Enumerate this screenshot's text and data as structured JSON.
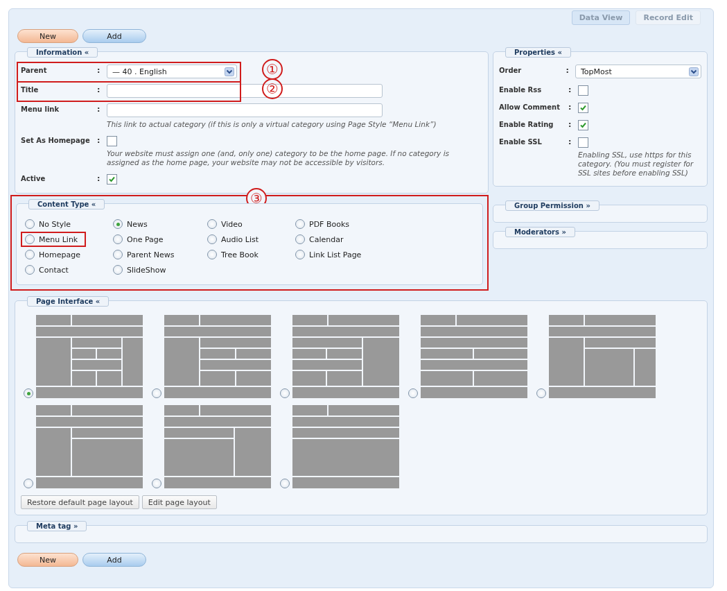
{
  "tabs": [
    {
      "label": "Data View",
      "selected": true
    },
    {
      "label": "Record Edit",
      "selected": false
    }
  ],
  "top_buttons": [
    {
      "label": "New",
      "kind": "primary"
    },
    {
      "label": "Add",
      "kind": "secondary"
    }
  ],
  "information": {
    "title": "Information «",
    "fields": [
      {
        "kind": "select",
        "label": "Parent",
        "colon": ":",
        "value": "— 40 . English",
        "highlighted": true,
        "callout": "①"
      },
      {
        "kind": "text",
        "label": "Title",
        "colon": ":",
        "highlighted": true,
        "callout": "②"
      },
      {
        "kind": "text",
        "label": "Menu link",
        "colon": ":",
        "hint": "This link to actual category (if this is only a virtual category using Page Style “Menu Link”)"
      },
      {
        "kind": "checkbox",
        "label": "Set As Homepage",
        "colon": ":",
        "checked": false,
        "hint": "Your website must assign one (and, only one) category to be the home page. If no category is assigned as the home page, your website may not be accessible by visitors."
      },
      {
        "kind": "checkbox",
        "label": "Active",
        "colon": ":",
        "checked": true
      }
    ]
  },
  "properties": {
    "title": "Properties «",
    "fields": [
      {
        "kind": "select",
        "label": "Order",
        "colon": ":",
        "value": "TopMost"
      },
      {
        "kind": "checkbox",
        "label": "Enable Rss",
        "colon": ":",
        "checked": false
      },
      {
        "kind": "checkbox",
        "label": "Allow Comment",
        "colon": ":",
        "checked": true
      },
      {
        "kind": "checkbox",
        "label": "Enable Rating",
        "colon": ":",
        "checked": true
      },
      {
        "kind": "checkbox",
        "label": "Enable SSL",
        "colon": ":",
        "checked": false,
        "hint": "Enabling SSL, use https for this category. (You must register for SSL sites before enabling SSL)"
      }
    ]
  },
  "content_type": {
    "title": "Content Type «",
    "highlighted": true,
    "callout": "③",
    "columns": [
      [
        {
          "label": "No Style",
          "selected": false,
          "highlighted": false
        },
        {
          "label": "Menu Link",
          "selected": false,
          "highlighted": true
        },
        {
          "label": "Homepage",
          "selected": false,
          "highlighted": false
        },
        {
          "label": "Contact",
          "selected": false,
          "highlighted": false
        }
      ],
      [
        {
          "label": "News",
          "selected": true,
          "highlighted": false
        },
        {
          "label": "One Page",
          "selected": false,
          "highlighted": false
        },
        {
          "label": "Parent News",
          "selected": false,
          "highlighted": false
        },
        {
          "label": "SlideShow",
          "selected": false,
          "highlighted": false
        }
      ],
      [
        {
          "label": "Video",
          "selected": false,
          "highlighted": false
        },
        {
          "label": "Audio List",
          "selected": false,
          "highlighted": false
        },
        {
          "label": "Tree Book",
          "selected": false,
          "highlighted": false
        }
      ],
      [
        {
          "label": "PDF Books",
          "selected": false,
          "highlighted": false
        },
        {
          "label": "Calendar",
          "selected": false,
          "highlighted": false
        },
        {
          "label": "Link List Page",
          "selected": false,
          "highlighted": false
        }
      ]
    ]
  },
  "group_permission": {
    "title": "Group Permission »"
  },
  "moderators": {
    "title": "Moderators »"
  },
  "page_interface": {
    "title": "Page Interface «",
    "layouts": [
      {
        "selected": true
      },
      {
        "selected": false
      },
      {
        "selected": false
      },
      {
        "selected": false
      },
      {
        "selected": false
      },
      {
        "selected": false
      },
      {
        "selected": false
      },
      {
        "selected": false
      }
    ],
    "buttons": [
      "Restore default page layout",
      "Edit page layout"
    ]
  },
  "meta_tag": {
    "title": "Meta tag »"
  },
  "bottom_buttons": [
    {
      "label": "New",
      "kind": "primary"
    },
    {
      "label": "Add",
      "kind": "secondary"
    }
  ]
}
